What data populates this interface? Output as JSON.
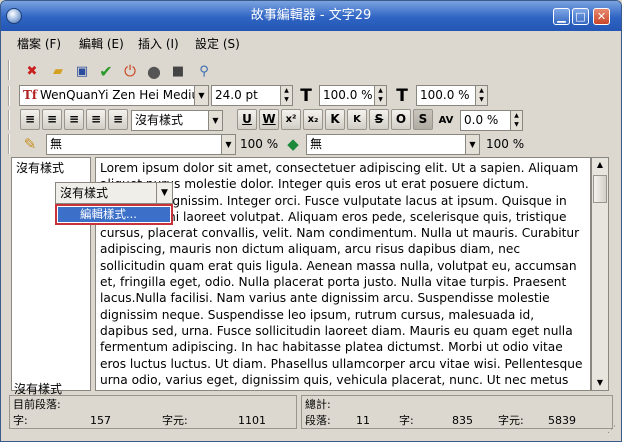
{
  "window": {
    "title": "故事編輯器 - 文字29"
  },
  "menubar": {
    "items": [
      "檔案 (F)",
      "編輯 (E)",
      "插入 (I)",
      "設定 (S)"
    ]
  },
  "toolbar3": {
    "style_value": "沒有樣式",
    "tracking": "0.0 %"
  },
  "toolbar2": {
    "font": "WenQuanYi Zen Hei Mediu",
    "size": "24.0 pt",
    "scale_w": "100.0 %",
    "scale_h": "100.0 %"
  },
  "toolbar4": {
    "stroke_value": "無",
    "stroke_pct": "100 %",
    "fill_value": "無",
    "fill_pct": "100 %"
  },
  "left_panel": {
    "top_label": "沒有樣式",
    "bottom_label": "沒有樣式"
  },
  "popup": {
    "combo": "沒有樣式",
    "item": "編輯樣式..."
  },
  "editor": {
    "text": "Lorem ipsum dolor sit amet, consectetuer adipiscing elit. Ut a sapien. Aliquam aliquet purus molestie dolor. Integer quis eros ut erat posuere dictum. Curabitur dignissim. Integer orci. Fusce vulputate lacus at ipsum. Quisque in libero nec mi laoreet volutpat. Aliquam eros pede, scelerisque quis, tristique cursus, placerat convallis, velit. Nam condimentum. Nulla ut mauris. Curabitur adipiscing, mauris non dictum aliquam, arcu risus dapibus diam, nec sollicitudin quam erat quis ligula. Aenean massa nulla, volutpat eu, accumsan et, fringilla eget, odio. Nulla placerat porta justo. Nulla vitae turpis. Praesent lacus.Nulla facilisi. Nam varius ante dignissim arcu. Suspendisse molestie dignissim neque. Suspendisse leo ipsum, rutrum cursus, malesuada id, dapibus sed, urna. Fusce sollicitudin laoreet diam. Mauris eu quam eget nulla fermentum adipiscing. In hac habitasse platea dictumst. Morbi ut odio vitae eros luctus luctus. Ut diam. Phasellus ullamcorper arcu vitae wisi. Pellentesque urna odio, varius eget, dignissim quis, vehicula placerat, nunc. Ut nec metus quis nulla posuere eleifend."
  },
  "status": {
    "current_label": "目前段落:",
    "char_label": "字:",
    "char_value": "157",
    "element_label": "字元:",
    "element_value": "1101",
    "total_label": "總計:",
    "para_label": "段落:",
    "para_value": "11",
    "word_label": "字:",
    "word_value": "835",
    "total_char_label": "字元:",
    "total_char_value": "5839"
  },
  "colors": {
    "title_bar": "#2f64c4",
    "selection": "#3c6fc8",
    "highlight_border": "#c8323a"
  }
}
